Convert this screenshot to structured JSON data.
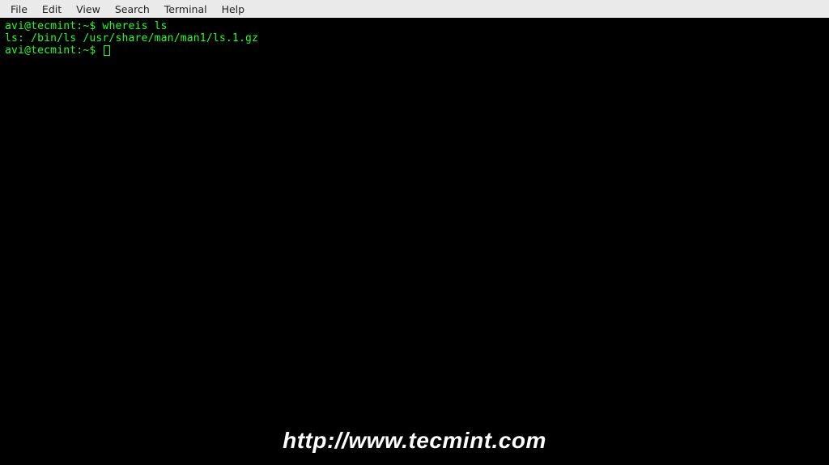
{
  "menubar": {
    "items": [
      "File",
      "Edit",
      "View",
      "Search",
      "Terminal",
      "Help"
    ]
  },
  "terminal": {
    "lines": [
      {
        "prompt": "avi@tecmint:~",
        "symbol": "$",
        "command": "whereis ls"
      },
      {
        "output": "ls: /bin/ls /usr/share/man/man1/ls.1.gz"
      },
      {
        "prompt": "avi@tecmint:~",
        "symbol": "$",
        "command": "",
        "cursor": true
      }
    ]
  },
  "watermark": "http://www.tecmint.com"
}
